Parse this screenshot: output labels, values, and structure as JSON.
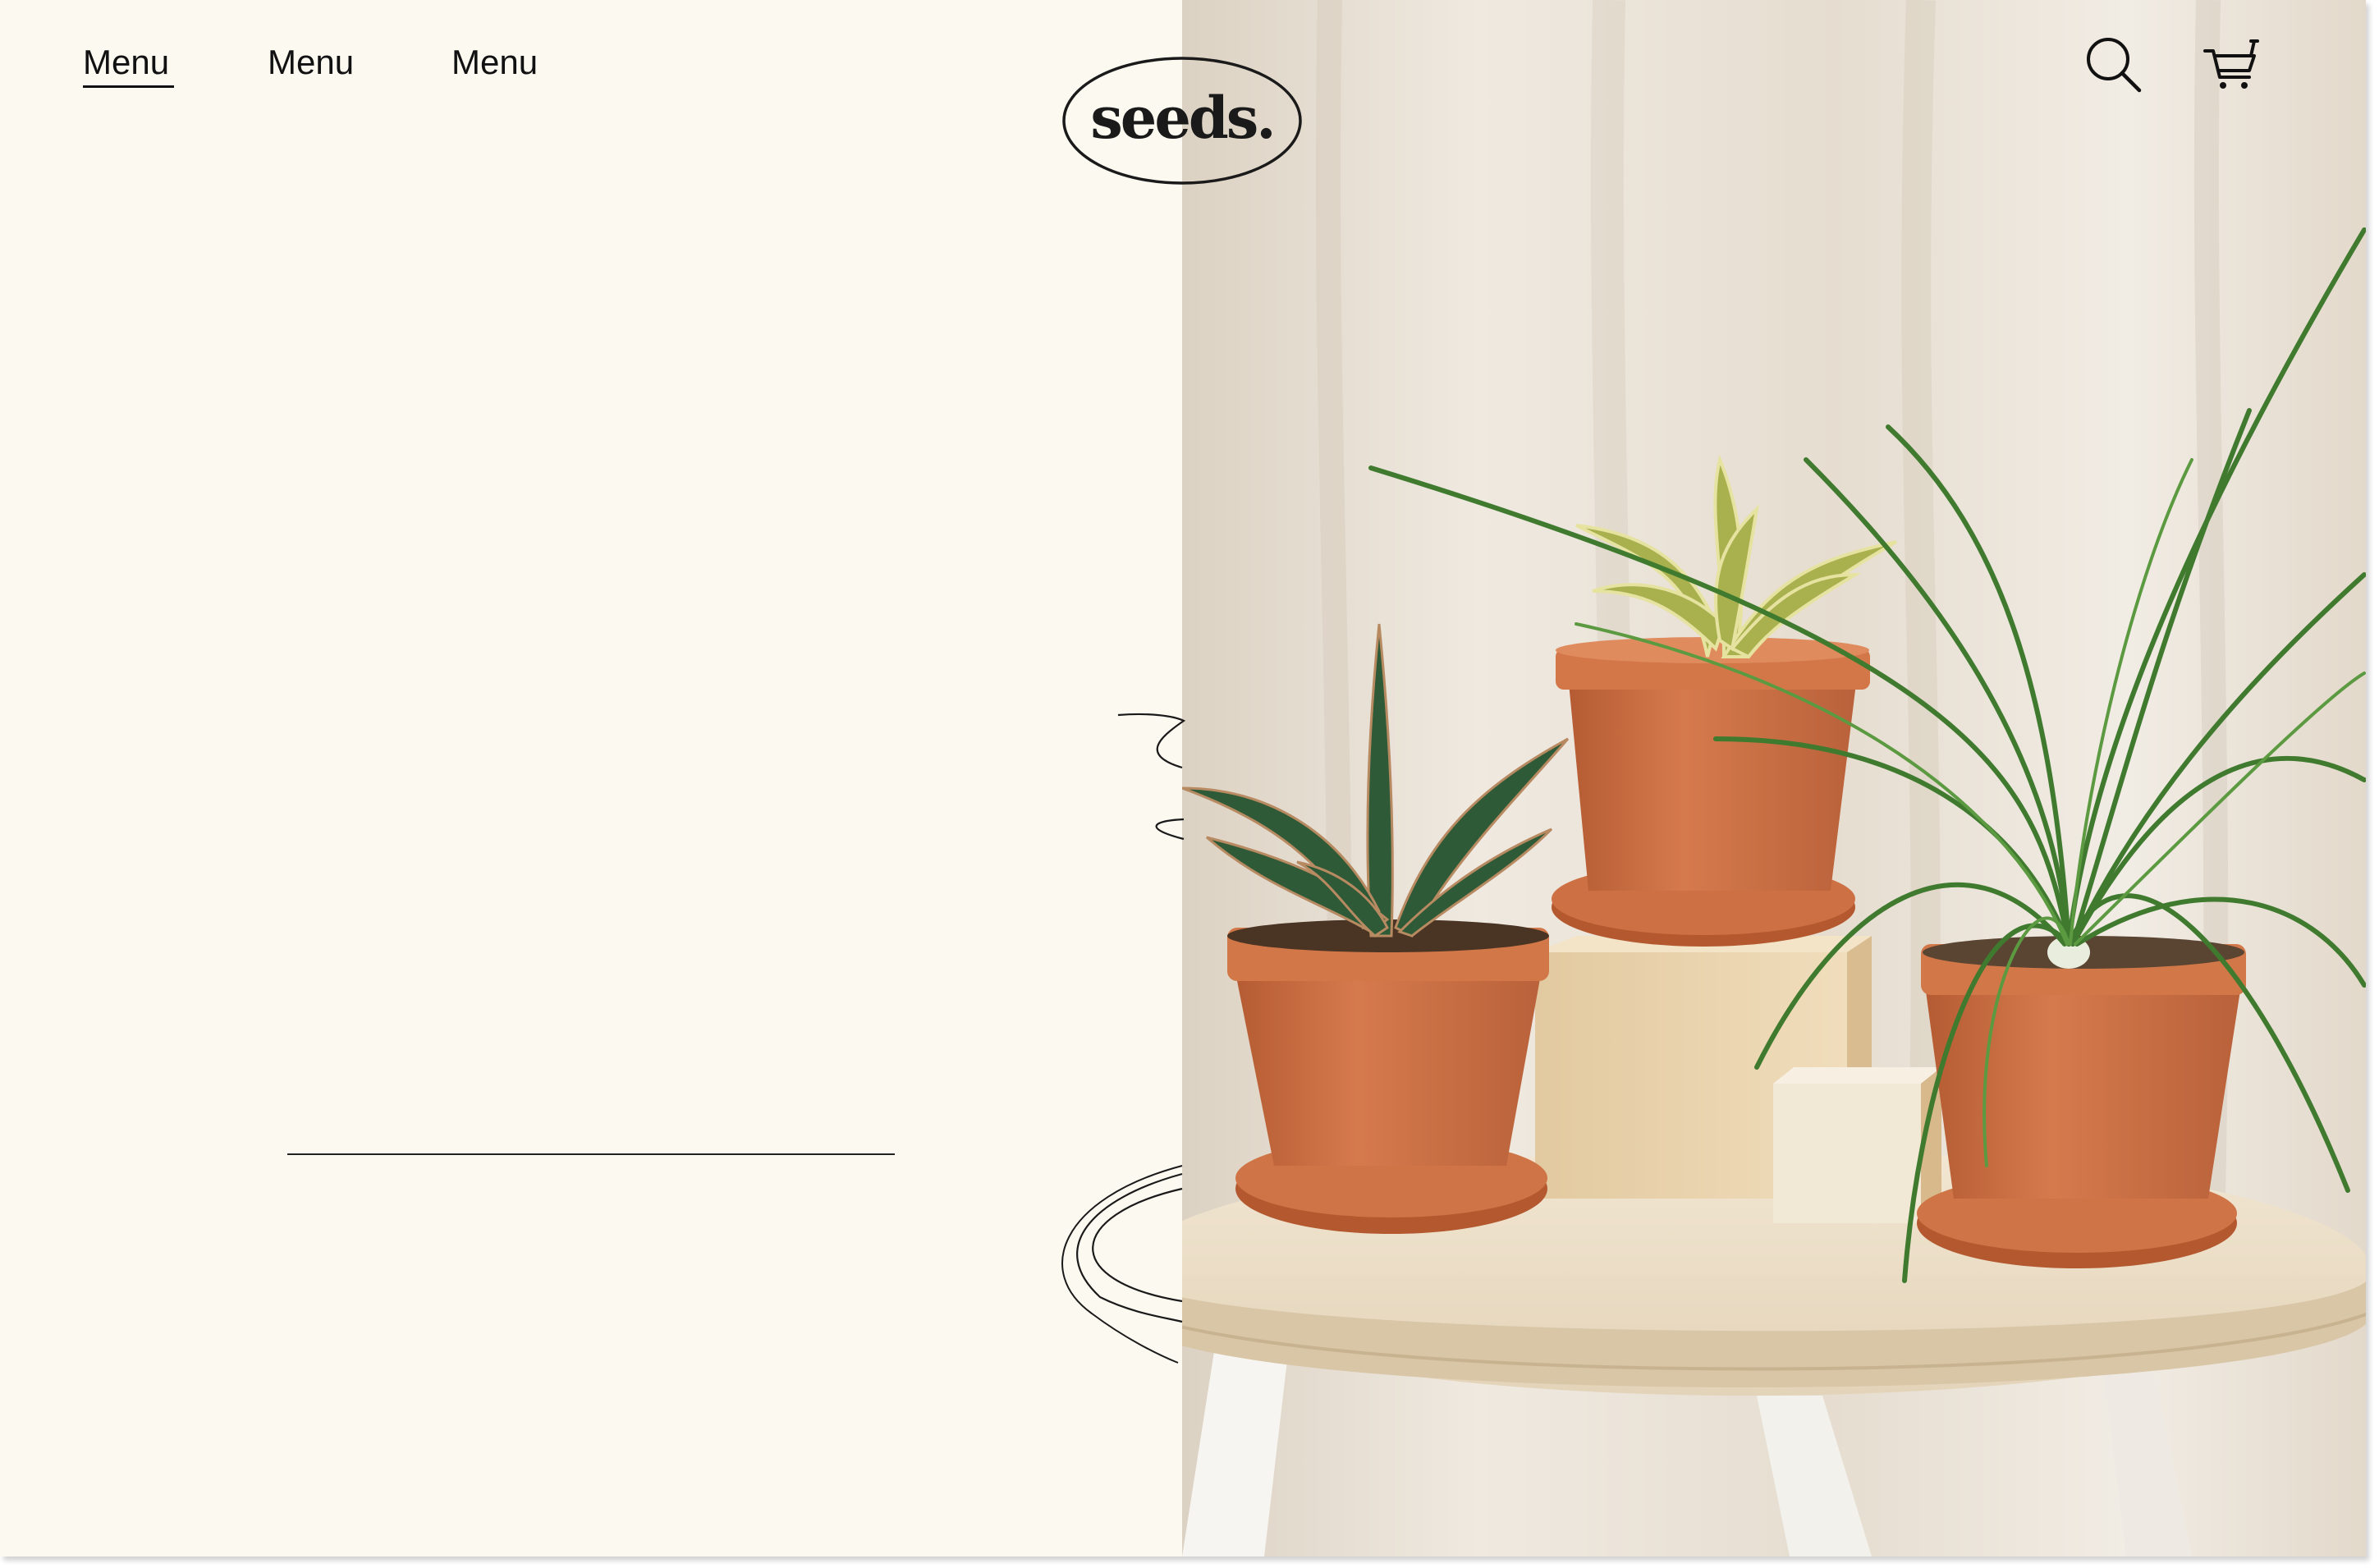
{
  "header": {
    "nav_items": [
      {
        "label": "Menu",
        "active": true
      },
      {
        "label": "Menu",
        "active": false
      },
      {
        "label": "Menu",
        "active": false
      }
    ],
    "logo_text": "seeds.",
    "icons": [
      "search-icon",
      "cart-icon"
    ]
  },
  "colors": {
    "background": "#fcf9f1",
    "text": "#111111",
    "terracotta": "#c8693f",
    "leaf": "#3f7a2f",
    "wood": "#eadbc2"
  }
}
